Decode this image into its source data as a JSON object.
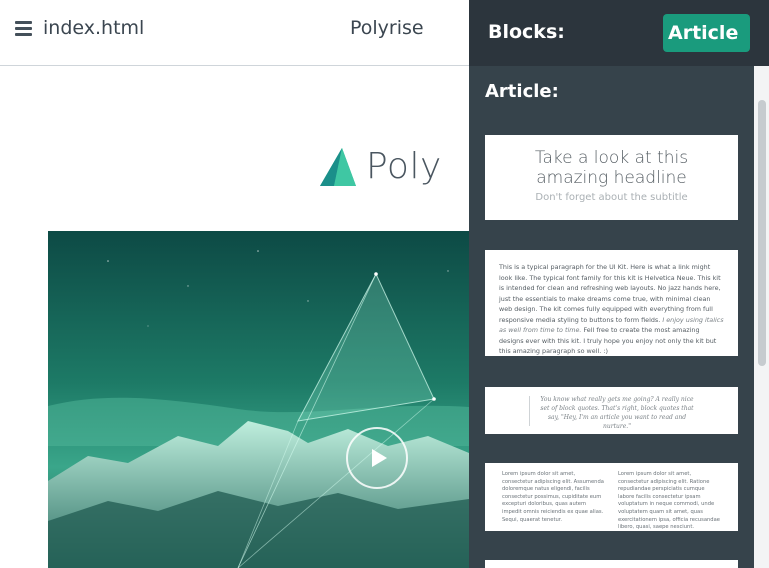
{
  "topbar": {
    "filename": "index.html",
    "project": "Polyrise"
  },
  "canvas": {
    "logo_text": "Poly",
    "hero_icon": "play-icon"
  },
  "panel": {
    "title": "Blocks:",
    "category": "Article",
    "section_title": "Article:",
    "blocks": {
      "headline": {
        "title": "Take a look at this amazing headline",
        "subtitle": "Don't forget about the subtitle"
      },
      "paragraph": {
        "text_before": "This is a typical paragraph for the UI Kit. Here is what a link might look like. The typical font family for this kit is Helvetica Neue. This kit is intended for clean and refreshing web layouts. No jazz hands here, just the essentials to make dreams come true, with minimal clean web design. The kit comes fully equipped with everything from full responsive media styling to buttons to form fields. ",
        "text_italic": "I enjoy using italics as well from time to time.",
        "text_after": " Fell free to create the most amazing designs ever with this kit. I truly hope you enjoy not only the kit but this amazing paragraph so well. :)"
      },
      "quote": {
        "text": "You know what really gets me going? A really nice set of block quotes. That's right, block quotes that say, \"Hey, I'm an article you want to read and nurture.\""
      },
      "two_column": {
        "left": "Lorem ipsum dolor sit amet, consectetur adipiscing elit. Assumenda doloremque natus eligendi, facilis consectetur possimus, cupiditate eum excepturi doloribus, quas autem impedit omnis reiciendis ex quae alias. Sequi, quaerat tenetur.",
        "right": "Lorem ipsum dolor sit amet, consectetur adipiscing elit. Ratione repudiandae perspiciatis cumque labore facilis consectetur ipsam voluptatum in neque commodi, unde voluptatem quam sit amet, quas exercitationem ipsa, officia recusandae libero, quasi, saepe nesciunt."
      }
    }
  },
  "colors": {
    "accent": "#1a9b7d",
    "panel_bg": "#36434b",
    "panel_header_bg": "#2c353d"
  }
}
